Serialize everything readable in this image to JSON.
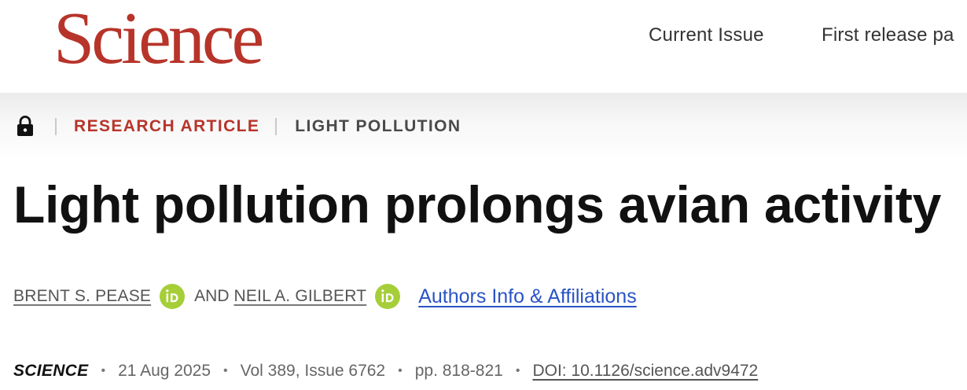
{
  "header": {
    "logo": "Science",
    "nav": {
      "current_issue": "Current Issue",
      "first_release": "First release pa"
    }
  },
  "breadcrumb": {
    "lock_icon": "lock-icon",
    "article_type": "RESEARCH ARTICLE",
    "topic": "LIGHT POLLUTION"
  },
  "article": {
    "title": "Light pollution prolongs avian activity",
    "authors": [
      {
        "name": "BRENT S. PEASE",
        "orcid_icon": "orcid-icon"
      },
      {
        "name": "NEIL A. GILBERT",
        "orcid_icon": "orcid-icon"
      }
    ],
    "and": "AND",
    "affiliations_link": "Authors Info & Affiliations"
  },
  "meta": {
    "journal": "SCIENCE",
    "date": "21 Aug 2025",
    "volume_issue": "Vol 389, Issue 6762",
    "pages": "pp. 818-821",
    "doi": "DOI: 10.1126/science.adv9472",
    "separator": "•"
  },
  "colors": {
    "brand_red": "#b7342a",
    "orcid_green": "#a6ce39",
    "link_blue": "#2a54c5"
  }
}
